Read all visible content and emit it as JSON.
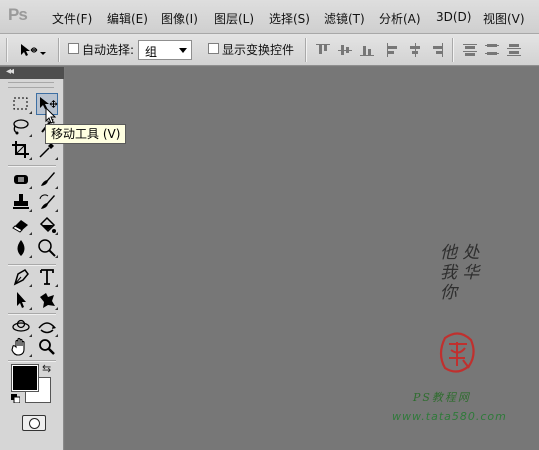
{
  "app": {
    "logo_text": "Ps"
  },
  "menu": {
    "items": [
      {
        "label": "文件(F)"
      },
      {
        "label": "编辑(E)"
      },
      {
        "label": "图像(I)"
      },
      {
        "label": "图层(L)"
      },
      {
        "label": "选择(S)"
      },
      {
        "label": "滤镜(T)"
      },
      {
        "label": "分析(A)"
      },
      {
        "label": "3D(D)"
      },
      {
        "label": "视图(V)"
      }
    ]
  },
  "options_bar": {
    "tool_icon": "move-tool-icon",
    "auto_select_label": "自动选择:",
    "auto_select_checked": false,
    "auto_select_value": "组",
    "show_transform_label": "显示变换控件",
    "show_transform_checked": false,
    "align_icons": [
      "align-top-edges-icon",
      "align-vertical-centers-icon",
      "align-bottom-edges-icon",
      "align-left-edges-icon",
      "align-horizontal-centers-icon",
      "align-right-edges-icon",
      "distribute-top-icon",
      "distribute-vertical-centers-icon",
      "distribute-bottom-icon"
    ]
  },
  "toolbox": {
    "collapse_glyph": "◂◂",
    "tools": [
      {
        "name": "rectangular-marquee-tool-icon"
      },
      {
        "name": "move-tool-icon",
        "active": true
      },
      {
        "name": "lasso-tool-icon"
      },
      {
        "name": "quick-selection-tool-icon"
      },
      {
        "name": "crop-tool-icon"
      },
      {
        "name": "eyedropper-tool-icon"
      },
      {
        "name": "spot-healing-brush-tool-icon"
      },
      {
        "name": "brush-tool-icon"
      },
      {
        "name": "clone-stamp-tool-icon"
      },
      {
        "name": "history-brush-tool-icon"
      },
      {
        "name": "eraser-tool-icon"
      },
      {
        "name": "paint-bucket-tool-icon"
      },
      {
        "name": "blur-tool-icon"
      },
      {
        "name": "dodge-tool-icon"
      },
      {
        "name": "pen-tool-icon"
      },
      {
        "name": "type-tool-icon"
      },
      {
        "name": "path-selection-tool-icon"
      },
      {
        "name": "custom-shape-tool-icon"
      },
      {
        "name": "3d-rotate-tool-icon"
      },
      {
        "name": "3d-orbit-tool-icon"
      },
      {
        "name": "hand-tool-icon"
      },
      {
        "name": "zoom-tool-icon"
      }
    ],
    "foreground_color": "#000000",
    "background_color": "#ffffff"
  },
  "tooltip": {
    "text": "移动工具 (V)"
  },
  "watermark": {
    "glyphs": [
      "他  处",
      "我  华",
      "你"
    ],
    "brand": "PS教程网",
    "url": "www.tata580.com"
  },
  "colors": {
    "canvas_bg": "#777777",
    "panel_bg": "#d6d6d6",
    "active_tool_border": "#3d6fa3",
    "seal_red": "#c0302e"
  }
}
